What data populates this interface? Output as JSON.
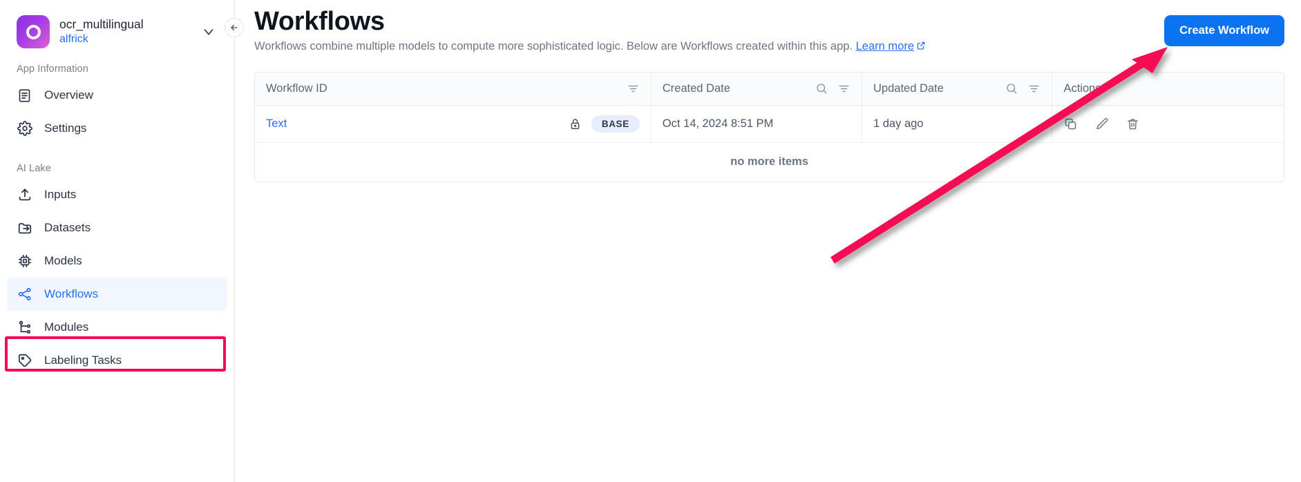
{
  "sidebar": {
    "app": {
      "name": "ocr_multilingual",
      "user": "alfrick",
      "logo_gradient_from": "#8b2fe0",
      "logo_gradient_to": "#e05fd0"
    },
    "sections": [
      {
        "label": "App Information",
        "items": [
          {
            "label": "Overview",
            "icon": "document-icon",
            "active": false
          },
          {
            "label": "Settings",
            "icon": "gear-icon",
            "active": false
          }
        ]
      },
      {
        "label": "AI Lake",
        "items": [
          {
            "label": "Inputs",
            "icon": "upload-icon",
            "active": false
          },
          {
            "label": "Datasets",
            "icon": "folder-icon",
            "active": false
          },
          {
            "label": "Models",
            "icon": "chip-icon",
            "active": false
          },
          {
            "label": "Workflows",
            "icon": "share-nodes-icon",
            "active": true
          },
          {
            "label": "Modules",
            "icon": "tree-branch-icon",
            "active": false
          },
          {
            "label": "Labeling Tasks",
            "icon": "tag-icon",
            "active": false
          }
        ]
      }
    ],
    "collapse_icon": "arrow-left-icon"
  },
  "header": {
    "title": "Workflows",
    "subtitle": "Workflows combine multiple models to compute more sophisticated logic. Below are Workflows created within this app.",
    "learn_more": "Learn more",
    "learn_more_icon": "external-link-icon",
    "create_button": "Create Workflow",
    "create_button_color": "#0b72f0"
  },
  "table": {
    "columns": [
      {
        "label": "Workflow ID",
        "tools": [
          "filter-icon"
        ]
      },
      {
        "label": "Created Date",
        "tools": [
          "search-icon",
          "filter-icon"
        ]
      },
      {
        "label": "Updated Date",
        "tools": [
          "search-icon",
          "filter-icon"
        ]
      },
      {
        "label": "Actions",
        "tools": []
      }
    ],
    "rows": [
      {
        "workflow_id": "Text",
        "lock_icon": "lock-icon",
        "badge": "BASE",
        "created_date": "Oct 14, 2024 8:51 PM",
        "updated_date": "1 day ago",
        "actions": [
          "copy-icon",
          "edit-pencil-icon",
          "trash-icon"
        ]
      }
    ],
    "footer_text": "no more items"
  },
  "annotations": {
    "highlight_color": "#f50a53",
    "box_target": "sidebar-item-workflows",
    "arrow_target": "create-workflow-button"
  }
}
